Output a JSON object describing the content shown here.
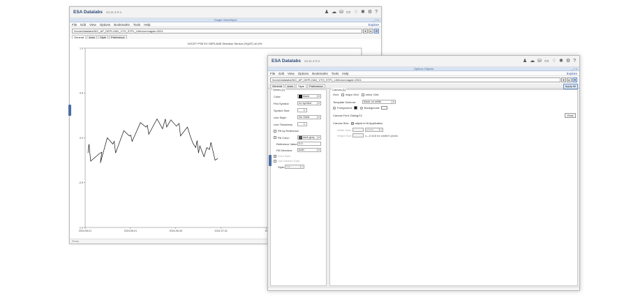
{
  "app": {
    "name": "ESA Datalabs",
    "version": "v3.11.2-0.1"
  },
  "plot_window": {
    "title": "Tangle ViewObject",
    "window_controls": "_ □ x",
    "menu": [
      "File",
      "Edit",
      "View",
      "Options",
      "Bookmarks",
      "Tools",
      "Help"
    ],
    "menu_right": "Explore",
    "path": "/home/datalabs/NIC_AP_DEPLOAD_VTH_STPL_Lifeboronnagain:2024",
    "tabs": [
      "General",
      "Axes",
      "Style",
      "Preference"
    ],
    "bottom_text": "Ready"
  },
  "chart_data": {
    "type": "line",
    "title": "VOCET PSE EV DEPLANE Direction Sensor (%)(ST) s0,0%",
    "x_ticks": [
      "2024-05-01",
      "2024-06-01",
      "2024-06-05",
      "2024-07-01"
    ],
    "x_last_tick_partial": "20",
    "y_ticks": [
      "1.0",
      "0.5",
      "0.0",
      "-0.5",
      "-1.0"
    ],
    "ylim": [
      -1.0,
      1.0
    ],
    "series": [
      {
        "values": [
          [
            0.01,
            -0.17
          ],
          [
            0.014,
            -0.07
          ],
          [
            0.02,
            -0.26
          ],
          [
            0.05,
            -0.18
          ],
          [
            0.06,
            -0.16
          ],
          [
            0.055,
            -0.28
          ],
          [
            0.08,
            0.0
          ],
          [
            0.1,
            -0.07
          ],
          [
            0.105,
            -0.04
          ],
          [
            0.11,
            -0.17
          ],
          [
            0.14,
            0.08
          ],
          [
            0.16,
            0.02
          ],
          [
            0.165,
            0.03
          ],
          [
            0.17,
            -0.04
          ],
          [
            0.2,
            0.17
          ],
          [
            0.22,
            0.12
          ],
          [
            0.225,
            0.14
          ],
          [
            0.23,
            0.04
          ],
          [
            0.26,
            0.21
          ],
          [
            0.28,
            0.1
          ],
          [
            0.29,
            0.21
          ],
          [
            0.295,
            0.12
          ],
          [
            0.31,
            0.2
          ],
          [
            0.33,
            0.13
          ],
          [
            0.34,
            0.16
          ],
          [
            0.345,
            0.02
          ],
          [
            0.37,
            0.12
          ],
          [
            0.38,
            0.02
          ],
          [
            0.39,
            -0.06
          ],
          [
            0.4,
            -0.11
          ],
          [
            0.405,
            -0.03
          ],
          [
            0.41,
            -0.17
          ],
          [
            0.415,
            -0.09
          ],
          [
            0.43,
            -0.21
          ],
          [
            0.44,
            -0.11
          ],
          [
            0.45,
            -0.13
          ],
          [
            0.455,
            -0.05
          ],
          [
            0.47,
            -0.25
          ],
          [
            0.475,
            -0.24
          ],
          [
            0.48,
            -0.23
          ]
        ]
      }
    ]
  },
  "settings_window": {
    "title": "Options Objects",
    "window_controls": "_ □ x",
    "menu": [
      "File",
      "Edit",
      "View",
      "Options",
      "Bookmarks",
      "Tools",
      "Help"
    ],
    "menu_right": "Explore",
    "path": "/home/datalabs/NIC_AP_DEPLOAD_VTH_STPL_Lifeboronnagain:2024",
    "tabs": [
      "General",
      "Axes",
      "Style",
      "Preference"
    ],
    "apply_label": "Apply All",
    "left_group": {
      "title": "Series [1]",
      "color_label": "Color:",
      "color_value": "black",
      "color_hex": "#111111",
      "plot_symbol_label": "Plot Symbol:",
      "plot_symbol_value": "no symbol",
      "symbol_size_label": "Symbol Size:",
      "symbol_size_value": "1",
      "line_style_label": "Line Style:",
      "line_style_value": "No Solid",
      "line_thickness_label": "Line Thickness:",
      "line_thickness_value": "1",
      "fill_ref_label": "Fill by Reference",
      "fill_color_label": "Fill Color:",
      "fill_color_value": "dark grey",
      "fill_color_hex": "#555555",
      "ref_value_label": "Reference Value:",
      "ref_value_value": "0.0",
      "fill_direction_label": "Fill Direction:",
      "fill_direction_value": "both",
      "error_bars_label": "Error Bars",
      "on_error_bars_label": "Use Marked Data",
      "style_label": "Style:",
      "style_value": "line"
    },
    "right_group": {
      "title": "Canvas [1]",
      "grid_label": "Grid:",
      "major_grid_label": "major Grid",
      "minor_grid_label": "minor Grid",
      "scheme_label": "Template Scheme:",
      "scheme_value": "black on white",
      "foreground_label": "Foreground:",
      "background_label": "Background:",
      "foreground_hex": "#111111",
      "background_hex": "#ffffff",
      "canvas_font_label": "Canvas Font: Dialog/12",
      "font_button": "Font",
      "canvas_size_label": "Canvas Size:",
      "adjust_label": "adjust to fit Application",
      "width_label": "Width Size:",
      "width_value": "",
      "width_unit": "pixels",
      "height_label": "Height Size:",
      "height_value": "",
      "height_hint": "x—0.618 for width/0 pixels"
    }
  }
}
